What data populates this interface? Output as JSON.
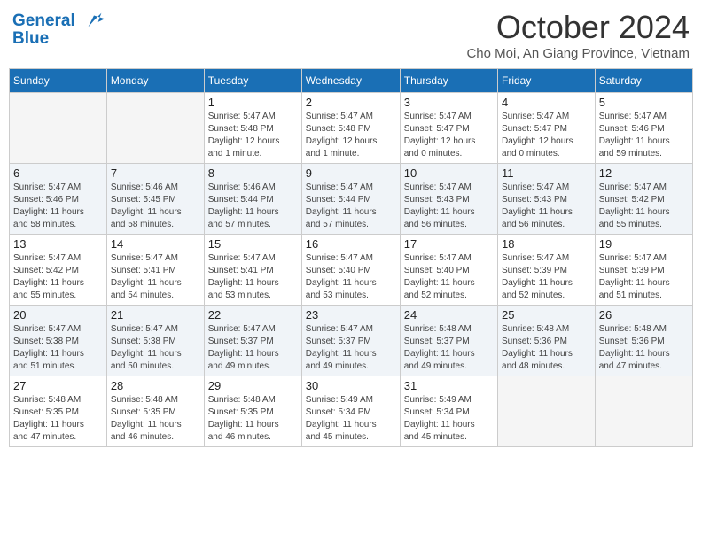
{
  "header": {
    "logo_line1": "General",
    "logo_line2": "Blue",
    "month": "October 2024",
    "location": "Cho Moi, An Giang Province, Vietnam"
  },
  "weekdays": [
    "Sunday",
    "Monday",
    "Tuesday",
    "Wednesday",
    "Thursday",
    "Friday",
    "Saturday"
  ],
  "weeks": [
    [
      {
        "day": "",
        "info": ""
      },
      {
        "day": "",
        "info": ""
      },
      {
        "day": "1",
        "info": "Sunrise: 5:47 AM\nSunset: 5:48 PM\nDaylight: 12 hours\nand 1 minute."
      },
      {
        "day": "2",
        "info": "Sunrise: 5:47 AM\nSunset: 5:48 PM\nDaylight: 12 hours\nand 1 minute."
      },
      {
        "day": "3",
        "info": "Sunrise: 5:47 AM\nSunset: 5:47 PM\nDaylight: 12 hours\nand 0 minutes."
      },
      {
        "day": "4",
        "info": "Sunrise: 5:47 AM\nSunset: 5:47 PM\nDaylight: 12 hours\nand 0 minutes."
      },
      {
        "day": "5",
        "info": "Sunrise: 5:47 AM\nSunset: 5:46 PM\nDaylight: 11 hours\nand 59 minutes."
      }
    ],
    [
      {
        "day": "6",
        "info": "Sunrise: 5:47 AM\nSunset: 5:46 PM\nDaylight: 11 hours\nand 58 minutes."
      },
      {
        "day": "7",
        "info": "Sunrise: 5:46 AM\nSunset: 5:45 PM\nDaylight: 11 hours\nand 58 minutes."
      },
      {
        "day": "8",
        "info": "Sunrise: 5:46 AM\nSunset: 5:44 PM\nDaylight: 11 hours\nand 57 minutes."
      },
      {
        "day": "9",
        "info": "Sunrise: 5:47 AM\nSunset: 5:44 PM\nDaylight: 11 hours\nand 57 minutes."
      },
      {
        "day": "10",
        "info": "Sunrise: 5:47 AM\nSunset: 5:43 PM\nDaylight: 11 hours\nand 56 minutes."
      },
      {
        "day": "11",
        "info": "Sunrise: 5:47 AM\nSunset: 5:43 PM\nDaylight: 11 hours\nand 56 minutes."
      },
      {
        "day": "12",
        "info": "Sunrise: 5:47 AM\nSunset: 5:42 PM\nDaylight: 11 hours\nand 55 minutes."
      }
    ],
    [
      {
        "day": "13",
        "info": "Sunrise: 5:47 AM\nSunset: 5:42 PM\nDaylight: 11 hours\nand 55 minutes."
      },
      {
        "day": "14",
        "info": "Sunrise: 5:47 AM\nSunset: 5:41 PM\nDaylight: 11 hours\nand 54 minutes."
      },
      {
        "day": "15",
        "info": "Sunrise: 5:47 AM\nSunset: 5:41 PM\nDaylight: 11 hours\nand 53 minutes."
      },
      {
        "day": "16",
        "info": "Sunrise: 5:47 AM\nSunset: 5:40 PM\nDaylight: 11 hours\nand 53 minutes."
      },
      {
        "day": "17",
        "info": "Sunrise: 5:47 AM\nSunset: 5:40 PM\nDaylight: 11 hours\nand 52 minutes."
      },
      {
        "day": "18",
        "info": "Sunrise: 5:47 AM\nSunset: 5:39 PM\nDaylight: 11 hours\nand 52 minutes."
      },
      {
        "day": "19",
        "info": "Sunrise: 5:47 AM\nSunset: 5:39 PM\nDaylight: 11 hours\nand 51 minutes."
      }
    ],
    [
      {
        "day": "20",
        "info": "Sunrise: 5:47 AM\nSunset: 5:38 PM\nDaylight: 11 hours\nand 51 minutes."
      },
      {
        "day": "21",
        "info": "Sunrise: 5:47 AM\nSunset: 5:38 PM\nDaylight: 11 hours\nand 50 minutes."
      },
      {
        "day": "22",
        "info": "Sunrise: 5:47 AM\nSunset: 5:37 PM\nDaylight: 11 hours\nand 49 minutes."
      },
      {
        "day": "23",
        "info": "Sunrise: 5:47 AM\nSunset: 5:37 PM\nDaylight: 11 hours\nand 49 minutes."
      },
      {
        "day": "24",
        "info": "Sunrise: 5:48 AM\nSunset: 5:37 PM\nDaylight: 11 hours\nand 49 minutes."
      },
      {
        "day": "25",
        "info": "Sunrise: 5:48 AM\nSunset: 5:36 PM\nDaylight: 11 hours\nand 48 minutes."
      },
      {
        "day": "26",
        "info": "Sunrise: 5:48 AM\nSunset: 5:36 PM\nDaylight: 11 hours\nand 47 minutes."
      }
    ],
    [
      {
        "day": "27",
        "info": "Sunrise: 5:48 AM\nSunset: 5:35 PM\nDaylight: 11 hours\nand 47 minutes."
      },
      {
        "day": "28",
        "info": "Sunrise: 5:48 AM\nSunset: 5:35 PM\nDaylight: 11 hours\nand 46 minutes."
      },
      {
        "day": "29",
        "info": "Sunrise: 5:48 AM\nSunset: 5:35 PM\nDaylight: 11 hours\nand 46 minutes."
      },
      {
        "day": "30",
        "info": "Sunrise: 5:49 AM\nSunset: 5:34 PM\nDaylight: 11 hours\nand 45 minutes."
      },
      {
        "day": "31",
        "info": "Sunrise: 5:49 AM\nSunset: 5:34 PM\nDaylight: 11 hours\nand 45 minutes."
      },
      {
        "day": "",
        "info": ""
      },
      {
        "day": "",
        "info": ""
      }
    ]
  ]
}
